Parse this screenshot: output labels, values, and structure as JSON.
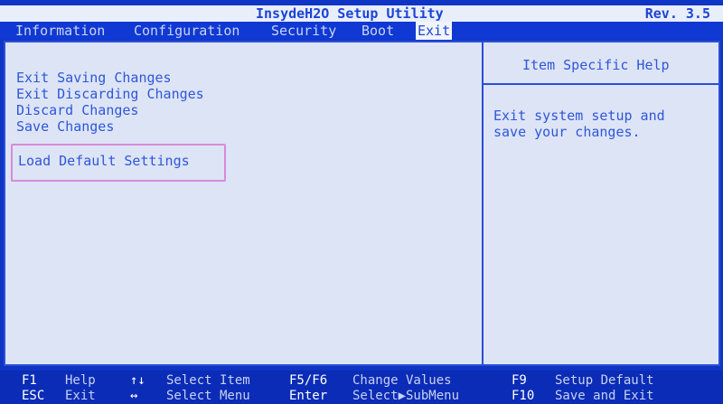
{
  "window": {
    "title": "InsydeH2O Setup Utility",
    "revision": "Rev. 3.5"
  },
  "menu": {
    "items": [
      "Information",
      "Configuration",
      "Security",
      "Boot",
      "Exit"
    ],
    "active": "Exit"
  },
  "options": [
    "Exit Saving Changes",
    "Exit Discarding Changes",
    "Discard Changes",
    "Save Changes",
    "Load Default Settings"
  ],
  "help": {
    "title": "Item Specific Help",
    "text": "Exit system setup and\nsave your changes."
  },
  "footer": {
    "keys": [
      {
        "key": "F1",
        "desc": "Help"
      },
      {
        "key": "ESC",
        "desc": "Exit"
      },
      {
        "key": "↑↓",
        "desc": "Select Item"
      },
      {
        "key": "↔",
        "desc": "Select Menu"
      },
      {
        "key": "F5/F6",
        "desc": "Change Values"
      },
      {
        "key": "Enter",
        "desc": "Select▶SubMenu"
      },
      {
        "key": "F9",
        "desc": "Setup Default"
      },
      {
        "key": "F10",
        "desc": "Save and Exit"
      }
    ]
  },
  "colors": {
    "background": "#0f35c4",
    "panel": "#dde4f5",
    "text_blue": "#2e57da",
    "highlight_border": "#d98ad8"
  }
}
